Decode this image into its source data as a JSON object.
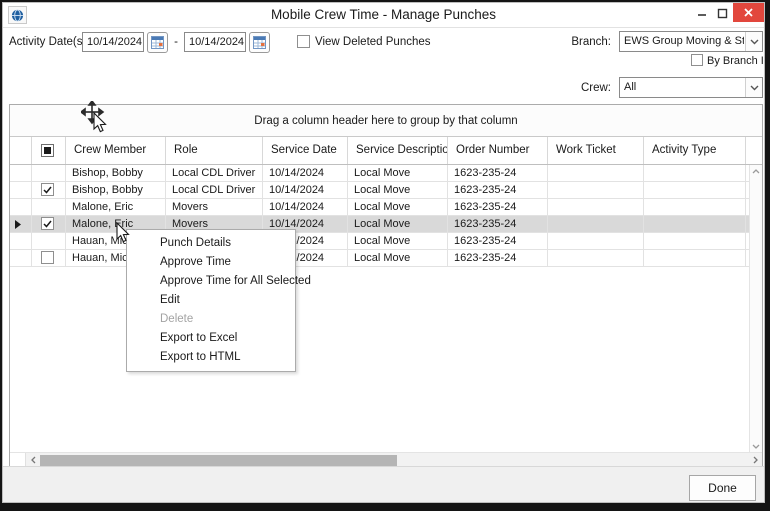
{
  "window": {
    "title": "Mobile Crew Time - Manage Punches",
    "icons": {
      "app": "globe-icon",
      "minimize": "minimize-icon",
      "maximize": "maximize-icon",
      "close": "close-icon"
    },
    "close_color": "#e2473d"
  },
  "filters": {
    "activity_label": "Activity Date(s):",
    "date_from": "10/14/2024",
    "date_separator": "-",
    "date_to": "10/14/2024",
    "view_deleted_label": "View Deleted Punches",
    "view_deleted_checked": false,
    "branch_label": "Branch:",
    "branch_value": "EWS Group Moving & Stor",
    "by_branch_id_label": "By Branch ID",
    "by_branch_id_checked": false,
    "crew_label": "Crew:",
    "crew_value": "All"
  },
  "grid": {
    "group_hint": "Drag a column header here to group by that column",
    "header_checkbox_state": "indeterminate",
    "columns": [
      "Crew Member",
      "Role",
      "Service Date",
      "Service Description",
      "Order Number",
      "Work Ticket",
      "Activity Type"
    ],
    "rows": [
      {
        "selected": false,
        "checkbox": "none",
        "cells": {
          "crew_member": "Bishop, Bobby",
          "role": "Local CDL Driver",
          "service_date": "10/14/2024",
          "service_description": "Local Move",
          "order_number": "1623-235-24",
          "work_ticket": "",
          "activity_type": ""
        }
      },
      {
        "selected": false,
        "checkbox": "checked",
        "cells": {
          "crew_member": "Bishop, Bobby",
          "role": "Local CDL Driver",
          "service_date": "10/14/2024",
          "service_description": "Local Move",
          "order_number": "1623-235-24",
          "work_ticket": "",
          "activity_type": ""
        }
      },
      {
        "selected": false,
        "checkbox": "none",
        "cells": {
          "crew_member": "Malone, Eric",
          "role": "Movers",
          "service_date": "10/14/2024",
          "service_description": "Local Move",
          "order_number": "1623-235-24",
          "work_ticket": "",
          "activity_type": ""
        }
      },
      {
        "selected": true,
        "checkbox": "checked",
        "cells": {
          "crew_member": "Malone, Eric",
          "role": "Movers",
          "service_date": "10/14/2024",
          "service_description": "Local Move",
          "order_number": "1623-235-24",
          "work_ticket": "",
          "activity_type": ""
        }
      },
      {
        "selected": false,
        "checkbox": "none",
        "cells": {
          "crew_member": "Hauan, Micha",
          "role": "",
          "service_date": "10/14/2024",
          "service_description": "Local Move",
          "order_number": "1623-235-24",
          "work_ticket": "",
          "activity_type": ""
        }
      },
      {
        "selected": false,
        "checkbox": "unchecked",
        "cells": {
          "crew_member": "Hauan, Micha",
          "role": "",
          "service_date": "10/14/2024",
          "service_description": "Local Move",
          "order_number": "1623-235-24",
          "work_ticket": "",
          "activity_type": ""
        }
      }
    ]
  },
  "context_menu": {
    "items": [
      {
        "label": "Punch Details",
        "enabled": true
      },
      {
        "label": "Approve Time",
        "enabled": true
      },
      {
        "label": "Approve Time for All Selected",
        "enabled": true
      },
      {
        "label": "Edit",
        "enabled": true
      },
      {
        "label": "Delete",
        "enabled": false
      },
      {
        "label": "Export to Excel",
        "enabled": true
      },
      {
        "label": "Export to HTML",
        "enabled": true
      }
    ]
  },
  "footer": {
    "done_label": "Done"
  }
}
